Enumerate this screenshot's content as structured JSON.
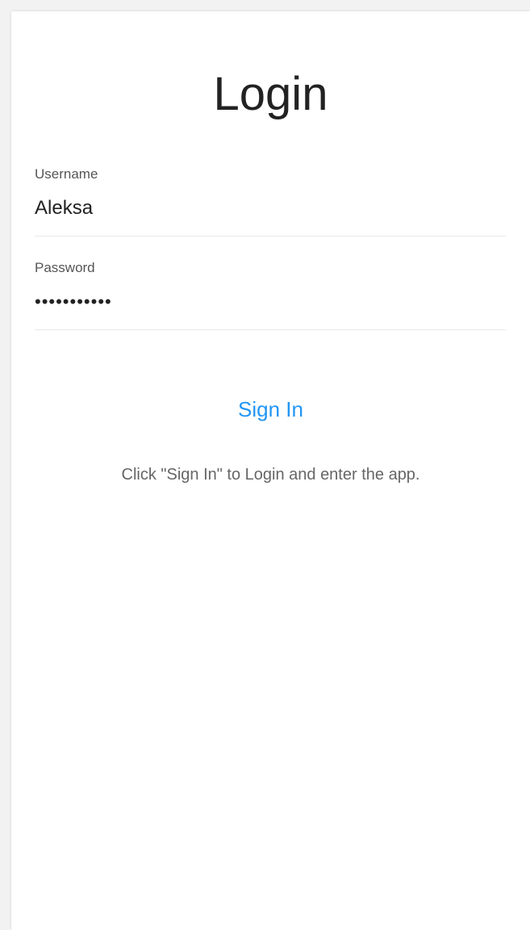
{
  "login": {
    "title": "Login",
    "username": {
      "label": "Username",
      "value": "Aleksa"
    },
    "password": {
      "label": "Password",
      "value": "•••••••••••"
    },
    "sign_in_label": "Sign In",
    "hint": "Click \"Sign In\" to Login and enter the app."
  },
  "colors": {
    "accent": "#2196f3",
    "background": "#f2f2f2",
    "card": "#ffffff",
    "text": "#222222",
    "muted": "#666666"
  }
}
